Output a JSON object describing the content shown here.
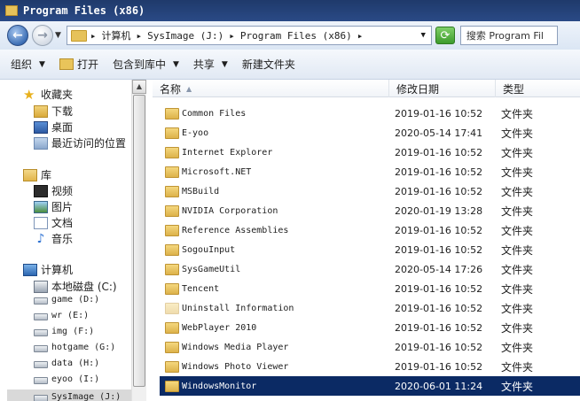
{
  "window": {
    "title": "Program Files (x86)"
  },
  "address": {
    "crumbs": [
      "计算机",
      "SysImage (J:)",
      "Program Files (x86)"
    ],
    "search_placeholder": "搜索 Program Fil"
  },
  "commands": {
    "organize": "组织",
    "open": "打开",
    "include_library": "包含到库中",
    "share": "共享",
    "new_folder": "新建文件夹"
  },
  "nav": {
    "favorites": {
      "label": "收藏夹",
      "items": [
        "下载",
        "桌面",
        "最近访问的位置"
      ]
    },
    "libraries": {
      "label": "库",
      "items": [
        "视频",
        "图片",
        "文档",
        "音乐"
      ]
    },
    "computer": {
      "label": "计算机",
      "local_disk": "本地磁盘 (C:)",
      "drives": [
        "game (D:)",
        "wr (E:)",
        "img (F:)",
        "hotgame (G:)",
        "data (H:)",
        "eyoo (I:)",
        "SysImage (J:)"
      ]
    }
  },
  "columns": {
    "name": "名称",
    "modified": "修改日期",
    "type": "类型"
  },
  "files": [
    {
      "name": "Common Files",
      "modified": "2019-01-16 10:52",
      "type": "文件夹"
    },
    {
      "name": "E-yoo",
      "modified": "2020-05-14 17:41",
      "type": "文件夹"
    },
    {
      "name": "Internet Explorer",
      "modified": "2019-01-16 10:52",
      "type": "文件夹"
    },
    {
      "name": "Microsoft.NET",
      "modified": "2019-01-16 10:52",
      "type": "文件夹"
    },
    {
      "name": "MSBuild",
      "modified": "2019-01-16 10:52",
      "type": "文件夹"
    },
    {
      "name": "NVIDIA Corporation",
      "modified": "2020-01-19 13:28",
      "type": "文件夹"
    },
    {
      "name": "Reference Assemblies",
      "modified": "2019-01-16 10:52",
      "type": "文件夹"
    },
    {
      "name": "SogouInput",
      "modified": "2019-01-16 10:52",
      "type": "文件夹"
    },
    {
      "name": "SysGameUtil",
      "modified": "2020-05-14 17:26",
      "type": "文件夹"
    },
    {
      "name": "Tencent",
      "modified": "2019-01-16 10:52",
      "type": "文件夹"
    },
    {
      "name": "Uninstall Information",
      "modified": "2019-01-16 10:52",
      "type": "文件夹"
    },
    {
      "name": "WebPlayer 2010",
      "modified": "2019-01-16 10:52",
      "type": "文件夹"
    },
    {
      "name": "Windows Media Player",
      "modified": "2019-01-16 10:52",
      "type": "文件夹"
    },
    {
      "name": "Windows Photo Viewer",
      "modified": "2019-01-16 10:52",
      "type": "文件夹"
    },
    {
      "name": "WindowsMonitor",
      "modified": "2020-06-01 11:24",
      "type": "文件夹"
    }
  ]
}
